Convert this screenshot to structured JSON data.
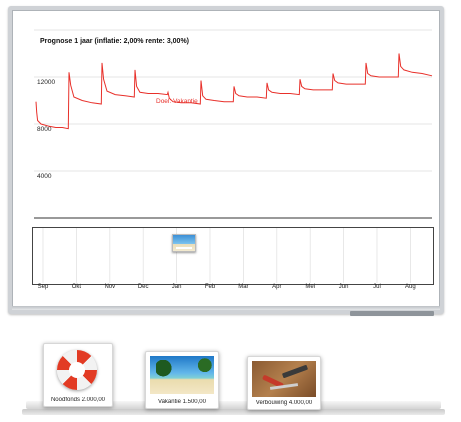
{
  "forecast": {
    "title": "Prognose 1 jaar (inflatie: 2,00% rente: 3,00%)",
    "annotation": "Doel: Vakantie",
    "line_color": "#e8302a"
  },
  "chart_data": {
    "type": "line",
    "title": "Prognose 1 jaar (inflatie: 2,00% rente: 3,00%)",
    "y_ticks": [
      "12000",
      "8000",
      "4000"
    ],
    "x_tick_labels": [
      "Sep",
      "Okt",
      "Nov",
      "Dec",
      "Jan",
      "Feb",
      "Mar",
      "Apr",
      "Mei",
      "Jun",
      "Jul",
      "Aug"
    ],
    "ylim": [
      0,
      16000
    ],
    "grid": true,
    "series": [
      {
        "color": "#e8302a",
        "x": [
          0,
          0.02,
          0.05,
          0.15,
          0.4,
          0.6,
          0.8,
          0.98,
          1.0,
          1.05,
          1.15,
          1.4,
          1.7,
          1.98,
          2.0,
          2.05,
          2.15,
          2.4,
          2.7,
          2.98,
          3.0,
          3.05,
          3.15,
          3.4,
          3.7,
          3.98,
          4.0,
          4.04,
          4.15,
          4.4,
          4.7,
          4.98,
          5.0,
          5.05,
          5.15,
          5.4,
          5.7,
          5.98,
          6.0,
          6.05,
          6.15,
          6.4,
          6.7,
          6.98,
          7.0,
          7.05,
          7.15,
          7.4,
          7.7,
          7.98,
          8.0,
          8.05,
          8.15,
          8.4,
          8.7,
          8.98,
          9.0,
          9.05,
          9.15,
          9.4,
          9.7,
          9.98,
          10.0,
          10.05,
          10.15,
          10.4,
          10.7,
          10.98,
          11.0,
          11.05,
          11.15,
          11.4,
          11.7,
          12.0
        ],
        "values": [
          9900,
          9000,
          8300,
          8000,
          7800,
          7700,
          7700,
          7600,
          12400,
          11300,
          10300,
          10000,
          9800,
          9700,
          13200,
          11800,
          10800,
          10500,
          10400,
          10300,
          12600,
          11200,
          10700,
          10600,
          10600,
          10500,
          10700,
          10200,
          9900,
          9800,
          9800,
          9700,
          11700,
          10400,
          10100,
          10000,
          9900,
          9900,
          11200,
          10600,
          10400,
          10300,
          10300,
          10200,
          11500,
          10900,
          10700,
          10600,
          10600,
          10500,
          11800,
          11200,
          11000,
          10900,
          10900,
          10900,
          12300,
          11700,
          11500,
          11400,
          11400,
          11400,
          13200,
          12300,
          12100,
          12000,
          12000,
          12000,
          14000,
          12900,
          12600,
          12400,
          12300,
          12100
        ]
      }
    ]
  },
  "timeline": {
    "months": [
      "Sep",
      "Okt",
      "Nov",
      "Dec",
      "Jan",
      "Feb",
      "Mar",
      "Apr",
      "Mei",
      "Jun",
      "Jul",
      "Aug"
    ]
  },
  "goals": [
    {
      "name": "Noodfonds",
      "amount": "2.000,00",
      "caption": "Noodfonds  2.000,00",
      "image": "lifebuoy-icon"
    },
    {
      "name": "Vakantie",
      "amount": "1.500,00",
      "caption": "Vakantie  1.500,00",
      "image": "beach-photo"
    },
    {
      "name": "Verbouwing",
      "amount": "4.000,00",
      "caption": "Verbouwing  4.000,00",
      "image": "tools-photo"
    }
  ]
}
